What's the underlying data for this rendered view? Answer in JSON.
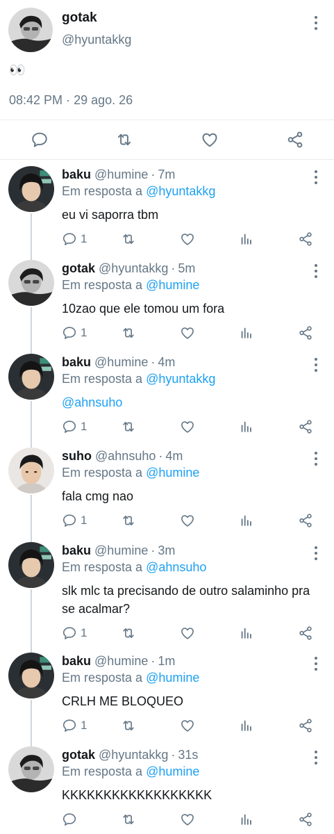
{
  "main_tweet": {
    "name": "gotak",
    "handle": "@hyuntakkg",
    "text": "👀",
    "time": "08:42 PM",
    "separator": "·",
    "date": "29 ago. 26"
  },
  "reply_prefix": "Em resposta a",
  "replies": [
    {
      "name": "baku",
      "handle": "@humine",
      "time": "7m",
      "reply_to": "@hyuntakkg",
      "text": "eu vi saporra tbm",
      "replies_count": "1",
      "avatar": "baku"
    },
    {
      "name": "gotak",
      "handle": "@hyuntakkg",
      "time": "5m",
      "reply_to": "@humine",
      "text": "10zao que ele tomou um fora",
      "replies_count": "1",
      "avatar": "gotak"
    },
    {
      "name": "baku",
      "handle": "@humine",
      "time": "4m",
      "reply_to": "@hyuntakkg",
      "text": "@ahnsuho",
      "replies_count": "1",
      "avatar": "baku"
    },
    {
      "name": "suho",
      "handle": "@ahnsuho",
      "time": "4m",
      "reply_to": "@humine",
      "text": "fala cmg nao",
      "replies_count": "1",
      "avatar": "suho"
    },
    {
      "name": "baku",
      "handle": "@humine",
      "time": "3m",
      "reply_to": "@ahnsuho",
      "text": "slk mlc ta precisando de outro salaminho pra se acalmar?",
      "replies_count": "1",
      "avatar": "baku"
    },
    {
      "name": "baku",
      "handle": "@humine",
      "time": "1m",
      "reply_to": "@humine",
      "text": "CRLH ME BLOQUEO",
      "replies_count": "1",
      "avatar": "baku"
    },
    {
      "name": "gotak",
      "handle": "@hyuntakkg",
      "time": "31s",
      "reply_to": "@humine",
      "text": "KKKKKKKKKKKKKKKKKK",
      "replies_count": "",
      "avatar": "gotak"
    }
  ],
  "colors": {
    "text": "#14171a",
    "secondary": "#657786",
    "link": "#1da1f2",
    "border": "#e6ecf0",
    "thread": "#ccd6dd"
  },
  "icons": [
    "reply-icon",
    "retweet-icon",
    "like-icon",
    "share-icon",
    "analytics-icon",
    "more-icon"
  ]
}
